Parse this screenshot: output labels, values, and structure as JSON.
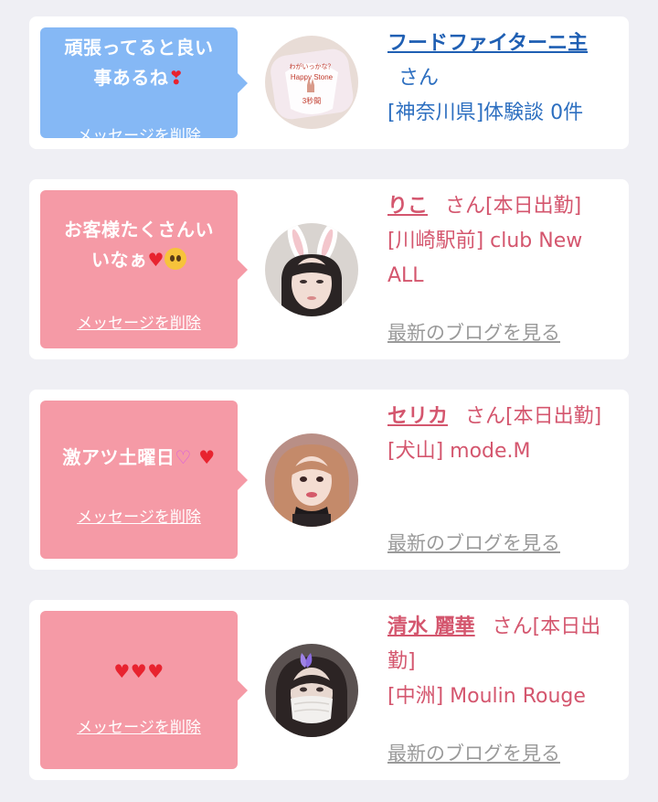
{
  "messages": [
    {
      "bubble_text_line1": "頑張ってると良い",
      "bubble_text_line2": "事あるね",
      "delete_label": "メッセージを削除",
      "name": "フードファイターニ主",
      "honorific": "さん",
      "location": "[神奈川県]体験談 0件",
      "theme": "#85b8f5"
    },
    {
      "bubble_text_line1": "お客様たくさんい",
      "bubble_text_line2": "いなぁ",
      "delete_label": "メッセージを削除",
      "name": "りこ",
      "honorific": "さん[本日出勤]",
      "location": "[川崎駅前] club New ALL",
      "blog_label": "最新のブログを見る",
      "theme": "#f59aa6"
    },
    {
      "bubble_text_line1": "激アツ土曜日",
      "delete_label": "メッセージを削除",
      "name": "セリカ",
      "honorific": "さん[本日出勤]",
      "location": "[犬山] mode.M",
      "blog_label": "最新のブログを見る",
      "theme": "#f59aa6"
    },
    {
      "delete_label": "メッセージを削除",
      "name": "清水 麗華",
      "honorific": "さん[本日出勤]",
      "location": "[中洲] Moulin Rouge",
      "blog_label": "最新のブログを見る",
      "theme": "#f59aa6"
    }
  ]
}
